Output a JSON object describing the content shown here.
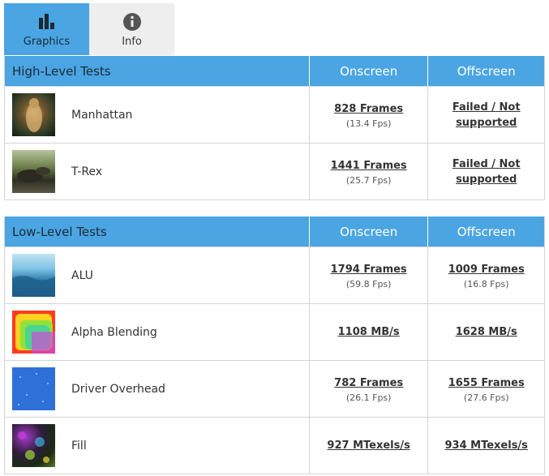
{
  "tabs": [
    {
      "label": "Graphics",
      "icon": "bar-chart-icon",
      "active": true
    },
    {
      "label": "Info",
      "icon": "info-icon",
      "active": false
    }
  ],
  "colors": {
    "header_blue": "#4aa5e2",
    "border": "#d5d5d5",
    "inactive_tab": "#eeeeee"
  },
  "high_level": {
    "title": "High-Level Tests",
    "col_onscreen": "Onscreen",
    "col_offscreen": "Offscreen",
    "rows": [
      {
        "name": "Manhattan",
        "thumb": "manhattan-thumbnail",
        "onscreen": "828 Frames",
        "onscreen_fps": "(13.4 Fps)",
        "offscreen": "Failed / Not supported",
        "offscreen_fps": ""
      },
      {
        "name": "T-Rex",
        "thumb": "trex-thumbnail",
        "onscreen": "1441 Frames",
        "onscreen_fps": "(25.7 Fps)",
        "offscreen": "Failed / Not supported",
        "offscreen_fps": ""
      }
    ]
  },
  "low_level": {
    "title": "Low-Level Tests",
    "col_onscreen": "Onscreen",
    "col_offscreen": "Offscreen",
    "rows": [
      {
        "name": "ALU",
        "thumb": "alu-thumbnail",
        "onscreen": "1794 Frames",
        "onscreen_fps": "(59.8 Fps)",
        "offscreen": "1009 Frames",
        "offscreen_fps": "(16.8 Fps)"
      },
      {
        "name": "Alpha Blending",
        "thumb": "alpha-blending-thumbnail",
        "onscreen": "1108 MB/s",
        "onscreen_fps": "",
        "offscreen": "1628 MB/s",
        "offscreen_fps": ""
      },
      {
        "name": "Driver Overhead",
        "thumb": "driver-overhead-thumbnail",
        "onscreen": "782 Frames",
        "onscreen_fps": "(26.1 Fps)",
        "offscreen": "1655 Frames",
        "offscreen_fps": "(27.6 Fps)"
      },
      {
        "name": "Fill",
        "thumb": "fill-thumbnail",
        "onscreen": "927 MTexels/s",
        "onscreen_fps": "",
        "offscreen": "934 MTexels/s",
        "offscreen_fps": ""
      }
    ]
  }
}
